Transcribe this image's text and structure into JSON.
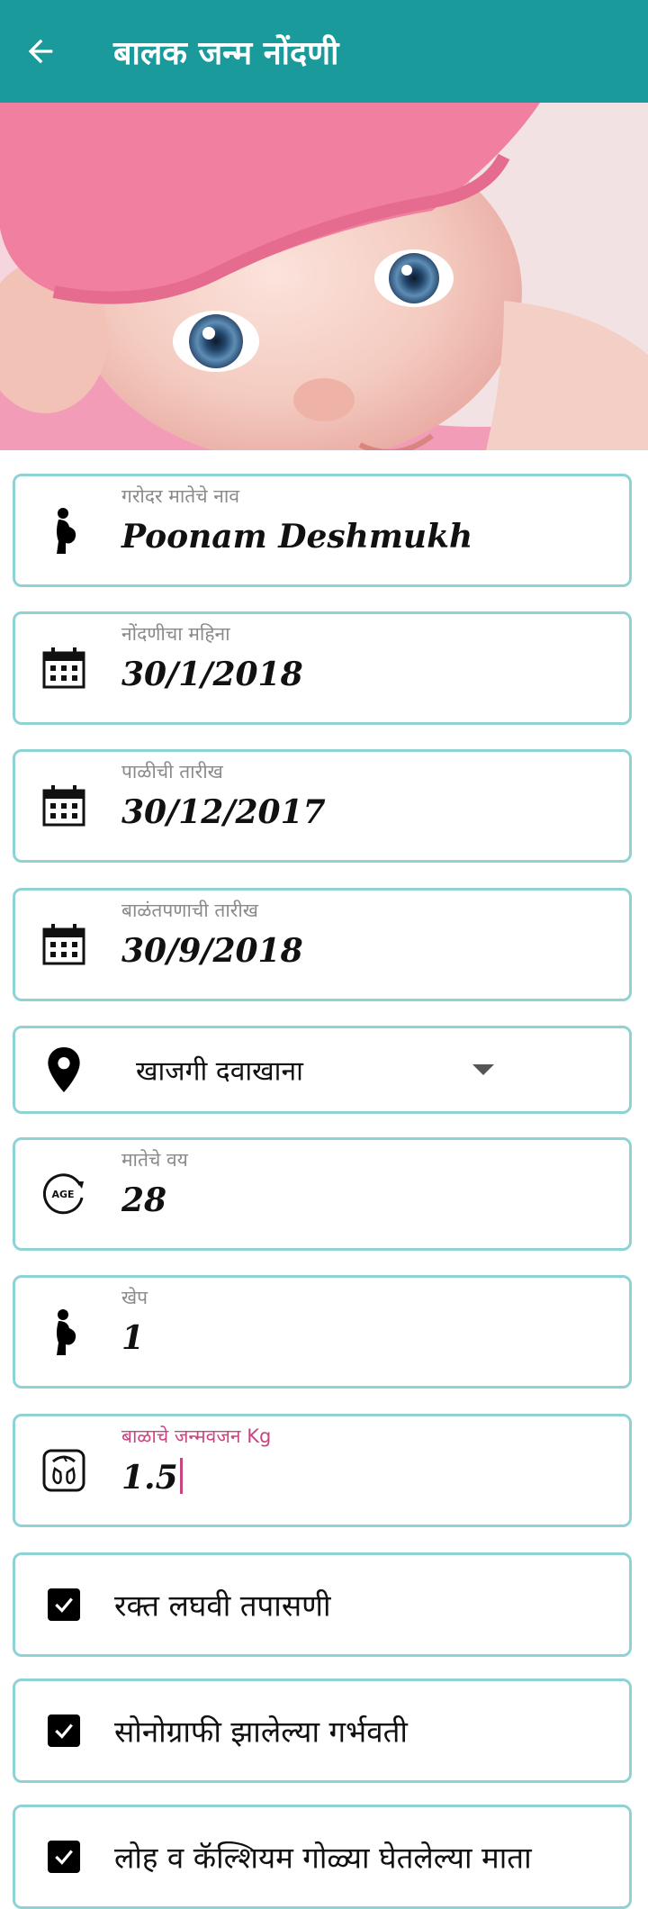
{
  "appbar": {
    "title": "बालक जन्म नोंदणी",
    "back_icon": "arrow-left-icon"
  },
  "hero": {
    "image": "baby-photo"
  },
  "fields": {
    "mother_name": {
      "label": "गरोदर मातेचे नाव",
      "value": "Poonam Deshmukh",
      "icon": "pregnant-woman-icon"
    },
    "registration_month": {
      "label": "नोंदणीचा महिना",
      "value": "30/1/2018",
      "icon": "calendar-icon"
    },
    "period_date": {
      "label": "पाळीची तारीख",
      "value": "30/12/2017",
      "icon": "calendar-icon"
    },
    "delivery_date": {
      "label": "बाळंतपणाची तारीख",
      "value": "30/9/2018",
      "icon": "calendar-icon"
    },
    "location": {
      "value": "खाजगी दवाखाना",
      "icon": "location-pin-icon"
    },
    "mother_age": {
      "label": "मातेचे वय",
      "value": "28",
      "icon": "age-icon"
    },
    "gravida": {
      "label": "खेप",
      "value": "1",
      "icon": "pregnant-woman-icon"
    },
    "birth_weight": {
      "label": "बाळाचे जन्मवजन Kg",
      "value": "1.5",
      "icon": "weighing-scale-icon"
    }
  },
  "checks": [
    {
      "label": "रक्त लघवी तपासणी",
      "checked": true
    },
    {
      "label": "सोनोग्राफी झालेल्या गर्भवती",
      "checked": true
    },
    {
      "label": "लोह व कॅल्शियम गोळ्या घेतलेल्या माता",
      "checked": true
    }
  ],
  "colors": {
    "primary": "#1a9a9b",
    "field_border": "#8fd2d3",
    "focus_accent": "#c9457f"
  }
}
